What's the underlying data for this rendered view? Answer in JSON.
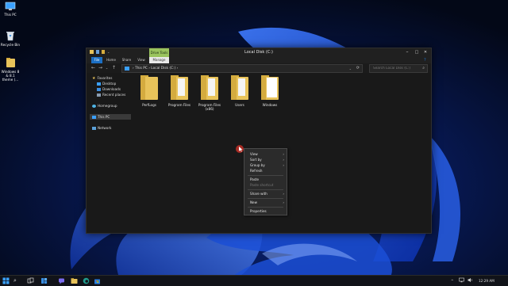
{
  "desktop": {
    "icons": [
      {
        "label": "This PC",
        "icon": "this-pc-icon"
      },
      {
        "label": "Recycle Bin",
        "icon": "recycle-bin-icon"
      },
      {
        "label": "Windows 8 & 8.1 theme (...",
        "icon": "folder-icon"
      }
    ]
  },
  "window": {
    "title": "Local Disk (C:)",
    "drive_tools_tab": "Drive Tools",
    "controls": {
      "minimize": "–",
      "maximize": "□",
      "close": "✕"
    },
    "ribbon_tabs": [
      "File",
      "Home",
      "Share",
      "View",
      "Manage"
    ],
    "address": {
      "back": "←",
      "forward": "→",
      "up": "↑",
      "recent": "⌄",
      "path": "›  This PC  ›  Local Disk (C:)  ›",
      "refresh": "⟳",
      "dropdown": "⌄"
    },
    "search": {
      "placeholder": "Search Local Disk (C:)"
    },
    "nav": {
      "items": [
        {
          "label": "Favorites",
          "icon": "star-icon"
        },
        {
          "label": "Desktop",
          "icon": "desktop-icon"
        },
        {
          "label": "Downloads",
          "icon": "downloads-icon"
        },
        {
          "label": "Recent places",
          "icon": "recent-places-icon"
        },
        {
          "label": "Homegroup",
          "icon": "homegroup-icon"
        },
        {
          "label": "This PC",
          "icon": "this-pc-icon"
        },
        {
          "label": "Network",
          "icon": "network-icon"
        }
      ]
    },
    "folders": [
      {
        "label": "PerfLogs",
        "variant": "plain"
      },
      {
        "label": "Program Files",
        "variant": "docs"
      },
      {
        "label": "Program Files (x86)",
        "variant": "docs"
      },
      {
        "label": "Users",
        "variant": "docs"
      },
      {
        "label": "Windows",
        "variant": "docs-white"
      }
    ]
  },
  "context_menu": {
    "items": [
      {
        "label": "View",
        "submenu": true,
        "disabled": false
      },
      {
        "label": "Sort by",
        "submenu": true,
        "disabled": false
      },
      {
        "label": "Group by",
        "submenu": true,
        "disabled": false
      },
      {
        "label": "Refresh",
        "submenu": false,
        "disabled": false
      },
      {
        "label": "Paste",
        "submenu": false,
        "disabled": false
      },
      {
        "label": "Paste shortcut",
        "submenu": false,
        "disabled": true
      },
      {
        "label": "Share with",
        "submenu": true,
        "disabled": false
      },
      {
        "label": "New",
        "submenu": true,
        "disabled": false
      },
      {
        "label": "Properties",
        "submenu": false,
        "disabled": false
      }
    ],
    "submenu_arrow": "›"
  },
  "taskbar": {
    "icons": [
      "start-icon",
      "search-icon",
      "task-view-icon",
      "widgets-icon",
      "chat-icon",
      "file-explorer-icon",
      "edge-icon",
      "store-icon"
    ],
    "tray": {
      "chevron": "^",
      "time": "12:29 AM"
    }
  },
  "colors": {
    "accent": "#1c6fc4",
    "drive_tools": "#9ac45e",
    "folder": "#e8c35a",
    "cursor": "#a82b24"
  }
}
